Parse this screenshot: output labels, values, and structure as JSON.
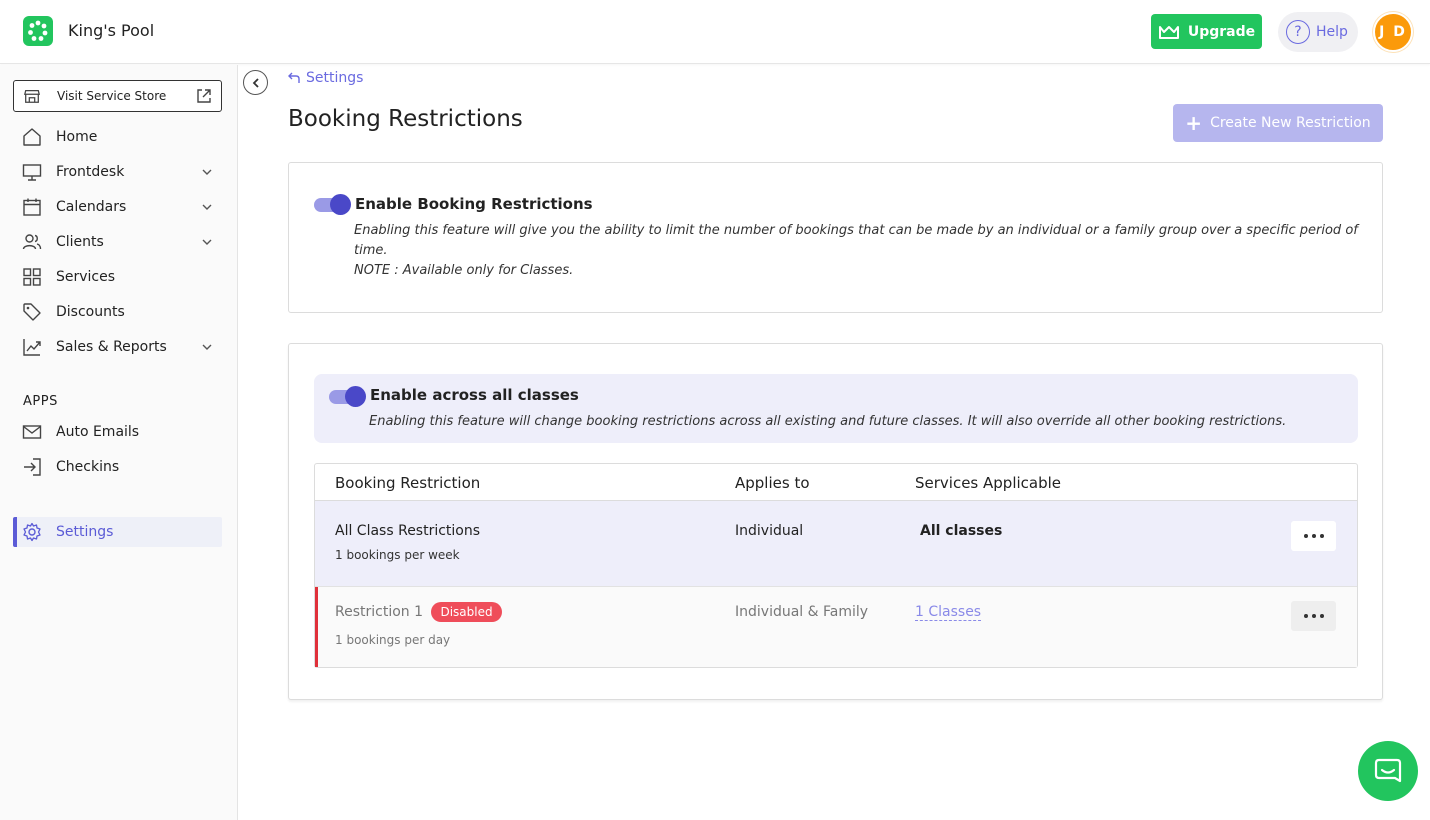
{
  "header": {
    "business_name": "King's Pool",
    "upgrade_label": "Upgrade",
    "help_label": "Help",
    "help_icon_glyph": "?",
    "avatar_initials": "J D",
    "brand_color": "#22c55e"
  },
  "sidebar": {
    "visit_store_label": "Visit Service Store",
    "items": [
      {
        "label": "Home",
        "icon": "home-icon"
      },
      {
        "label": "Frontdesk",
        "icon": "monitor-icon",
        "expandable": true
      },
      {
        "label": "Calendars",
        "icon": "calendar-icon",
        "expandable": true
      },
      {
        "label": "Clients",
        "icon": "users-icon",
        "expandable": true
      },
      {
        "label": "Services",
        "icon": "grid-icon"
      },
      {
        "label": "Discounts",
        "icon": "tag-icon"
      },
      {
        "label": "Sales & Reports",
        "icon": "chart-icon",
        "expandable": true
      }
    ],
    "apps_label": "APPS",
    "apps": [
      {
        "label": "Auto Emails",
        "icon": "mail-icon"
      },
      {
        "label": "Checkins",
        "icon": "login-icon"
      }
    ],
    "active_item": {
      "label": "Settings",
      "icon": "gear-icon"
    }
  },
  "main": {
    "back_label": "Settings",
    "title": "Booking Restrictions",
    "create_label": "Create New Restriction",
    "enable_card": {
      "title": "Enable Booking Restrictions",
      "enabled": true,
      "description": "Enabling this feature will give you the ability to limit the number of bookings that can be made by an individual or a family group over a specific period of",
      "description_cont": "time.",
      "note": "NOTE : Available only for Classes."
    },
    "all_classes": {
      "title": "Enable across all classes",
      "enabled": true,
      "description": "Enabling this feature will change booking restrictions across all existing and future classes. It will also override all other booking restrictions."
    },
    "table": {
      "headers": [
        "Booking Restriction",
        "Applies to",
        "Services Applicable"
      ],
      "rows": [
        {
          "name": "All Class Restrictions",
          "detail": "1 bookings per week",
          "applies_to": "Individual",
          "services": "All classes",
          "status": ""
        },
        {
          "name": "Restriction 1",
          "detail": "1 bookings per day",
          "applies_to": "Individual & Family",
          "services": "1 Classes",
          "status": "Disabled"
        }
      ]
    }
  }
}
